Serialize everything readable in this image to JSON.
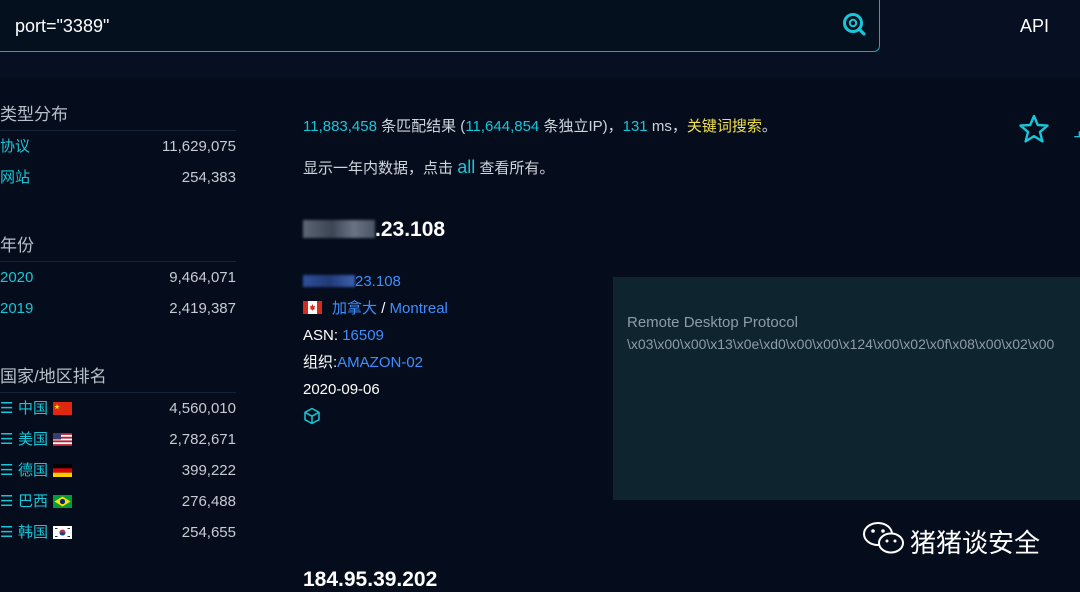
{
  "search": {
    "query": "port=\"3389\""
  },
  "header": {
    "api_label": "API"
  },
  "sidebar": {
    "sections": [
      {
        "title": "类型分布",
        "rows": [
          {
            "label": "协议",
            "value": "11,629,075"
          },
          {
            "label": "网站",
            "value": "254,383"
          }
        ]
      },
      {
        "title": "年份",
        "rows": [
          {
            "label": "2020",
            "value": "9,464,071"
          },
          {
            "label": "2019",
            "value": "2,419,387"
          }
        ]
      },
      {
        "title": "国家/地区排名",
        "rows": [
          {
            "label": "中国",
            "value": "4,560,010",
            "flag": "cn"
          },
          {
            "label": "美国",
            "value": "2,782,671",
            "flag": "us"
          },
          {
            "label": "德国",
            "value": "399,222",
            "flag": "de"
          },
          {
            "label": "巴西",
            "value": "276,488",
            "flag": "br"
          },
          {
            "label": "韩国",
            "value": "254,655",
            "flag": "kr"
          }
        ]
      }
    ]
  },
  "summary": {
    "total": "11,883,458",
    "total_label": "条匹配结果 (",
    "unique": "11,644,854",
    "unique_label": "条独立IP)，",
    "ms": "131",
    "ms_label": "ms，",
    "keyword": "关键词搜索",
    "end": "。"
  },
  "note": {
    "prefix": "显示一年内数据，点击",
    "link": "all",
    "suffix": "查看所有。"
  },
  "result": {
    "ip_suffix": ".23.108",
    "link_suffix": "23.108",
    "country": "加拿大",
    "separator": "/",
    "city": "Montreal",
    "asn_label": "ASN:",
    "asn": "16509",
    "org_label": "组织:",
    "org": "AMAZON-02",
    "date": "2020-09-06",
    "banner_title": "Remote Desktop Protocol",
    "banner_data": "\\x03\\x00\\x00\\x13\\x0e\\xd0\\x00\\x00\\x124\\x00\\x02\\x0f\\x08\\x00\\x02\\x00"
  },
  "next_result": {
    "ip": "184.95.39.202"
  },
  "watermark": {
    "text": "猪猪谈安全"
  },
  "colors": {
    "accent": "#17c6d8",
    "link": "#3d8eff",
    "keyword": "#f0e04a",
    "background": "#050d1c"
  }
}
